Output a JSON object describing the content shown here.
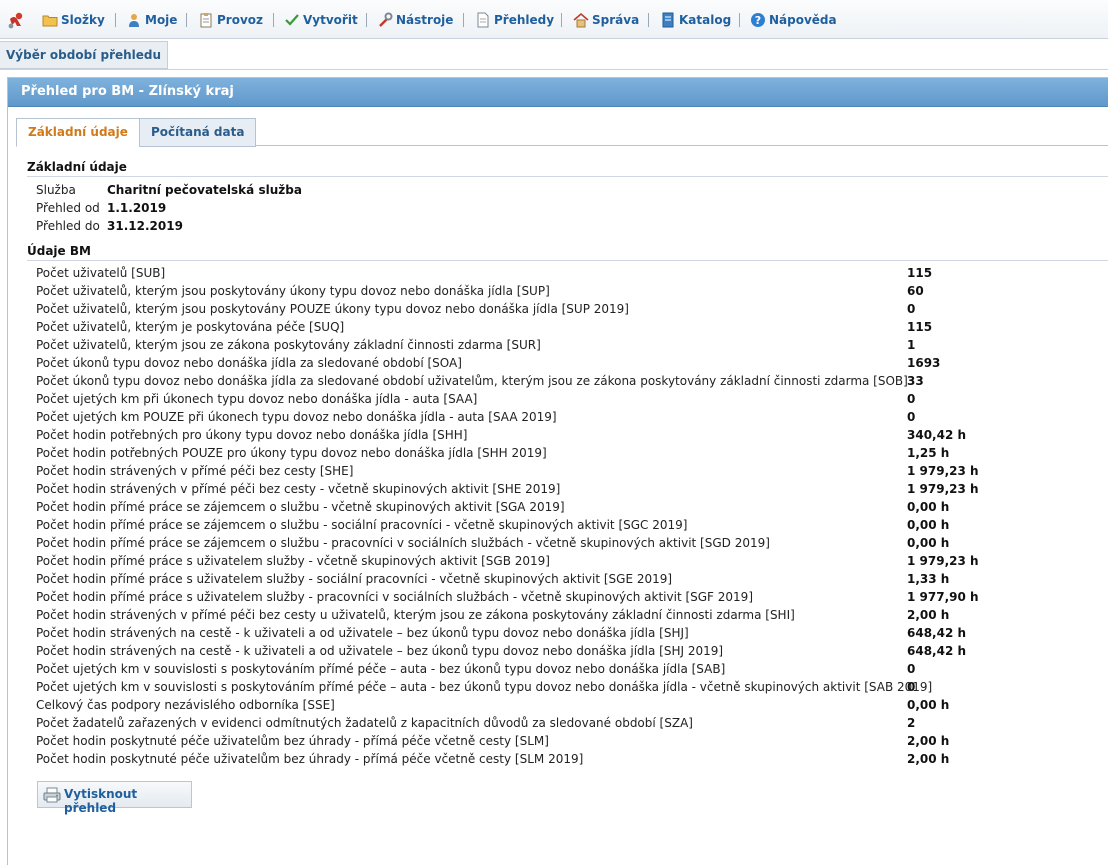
{
  "menu": {
    "items": [
      {
        "label": "Složky",
        "icon": "folder-icon"
      },
      {
        "label": "Moje",
        "icon": "user-icon"
      },
      {
        "label": "Provoz",
        "icon": "clipboard-icon"
      },
      {
        "label": "Vytvořit",
        "icon": "checkmark-icon"
      },
      {
        "label": "Nástroje",
        "icon": "wrench-icon"
      },
      {
        "label": "Přehledy",
        "icon": "document-icon"
      },
      {
        "label": "Správa",
        "icon": "home-icon"
      },
      {
        "label": "Katalog",
        "icon": "book-icon"
      },
      {
        "label": "Nápověda",
        "icon": "help-icon"
      }
    ]
  },
  "subtab": {
    "label": "Výběr období přehledu"
  },
  "panel": {
    "title": "Přehled pro BM - Zlínský kraj",
    "tabs": [
      {
        "label": "Základní údaje",
        "active": true
      },
      {
        "label": "Počítaná data",
        "active": false
      }
    ]
  },
  "basic": {
    "heading": "Základní údaje",
    "rows": [
      {
        "label": "Služba",
        "value": "Charitní pečovatelská služba"
      },
      {
        "label": "Přehled od",
        "value": "1.1.2019"
      },
      {
        "label": "Přehled do",
        "value": "31.12.2019"
      }
    ]
  },
  "bm": {
    "heading": "Údaje BM",
    "rows": [
      {
        "label": "Počet uživatelů [SUB]",
        "value": "115"
      },
      {
        "label": "Počet uživatelů, kterým jsou poskytovány úkony typu dovoz nebo donáška jídla [SUP]",
        "value": "60"
      },
      {
        "label": "Počet uživatelů, kterým jsou poskytovány POUZE úkony typu dovoz nebo donáška jídla [SUP 2019]",
        "value": "0"
      },
      {
        "label": "Počet uživatelů, kterým je poskytována péče [SUQ]",
        "value": "115"
      },
      {
        "label": "Počet uživatelů, kterým jsou ze zákona poskytovány základní činnosti zdarma [SUR]",
        "value": "1"
      },
      {
        "label": "Počet úkonů typu dovoz nebo donáška jídla za sledované období [SOA]",
        "value": "1693"
      },
      {
        "label": "Počet úkonů typu dovoz nebo donáška jídla za sledované období uživatelům, kterým jsou ze zákona poskytovány základní činnosti zdarma [SOB]",
        "value": "33"
      },
      {
        "label": "Počet ujetých km při úkonech typu dovoz nebo donáška jídla - auta [SAA]",
        "value": "0"
      },
      {
        "label": "Počet ujetých km POUZE při úkonech typu dovoz nebo donáška jídla - auta [SAA 2019]",
        "value": "0"
      },
      {
        "label": "Počet hodin potřebných pro úkony typu dovoz nebo donáška jídla [SHH]",
        "value": "340,42 h"
      },
      {
        "label": "Počet hodin potřebných POUZE pro úkony typu dovoz nebo donáška jídla [SHH 2019]",
        "value": "1,25 h"
      },
      {
        "label": "Počet hodin strávených v přímé péči bez cesty [SHE]",
        "value": "1 979,23 h"
      },
      {
        "label": "Počet hodin strávených v přímé péči bez cesty - včetně skupinových aktivit [SHE 2019]",
        "value": "1 979,23 h"
      },
      {
        "label": "Počet hodin přímé práce se zájemcem o službu - včetně skupinových aktivit [SGA 2019]",
        "value": "0,00 h"
      },
      {
        "label": "Počet hodin přímé práce se zájemcem o službu - sociální pracovníci - včetně skupinových aktivit [SGC 2019]",
        "value": "0,00 h"
      },
      {
        "label": "Počet hodin přímé práce se zájemcem o službu - pracovníci v sociálních službách - včetně skupinových aktivit [SGD 2019]",
        "value": "0,00 h"
      },
      {
        "label": "Počet hodin přímé práce s uživatelem služby - včetně skupinových aktivit [SGB 2019]",
        "value": "1 979,23 h"
      },
      {
        "label": "Počet hodin přímé práce s uživatelem služby - sociální pracovníci - včetně skupinových aktivit [SGE 2019]",
        "value": "1,33 h"
      },
      {
        "label": "Počet hodin přímé práce s uživatelem služby - pracovníci v sociálních službách - včetně skupinových aktivit [SGF 2019]",
        "value": "1 977,90 h"
      },
      {
        "label": "Počet hodin strávených v přímé péči bez cesty u uživatelů, kterým jsou ze zákona poskytovány základní činnosti zdarma [SHI]",
        "value": "2,00 h"
      },
      {
        "label": "Počet hodin strávených na cestě - k uživateli a od uživatele – bez úkonů typu dovoz nebo donáška jídla [SHJ]",
        "value": "648,42 h"
      },
      {
        "label": "Počet hodin strávených na cestě - k uživateli a od uživatele – bez úkonů typu dovoz nebo donáška jídla [SHJ 2019]",
        "value": "648,42 h"
      },
      {
        "label": "Počet ujetých km v souvislosti s poskytováním přímé péče – auta - bez úkonů typu dovoz nebo donáška jídla [SAB]",
        "value": "0"
      },
      {
        "label": "Počet ujetých km v souvislosti s poskytováním přímé péče – auta - bez úkonů typu dovoz nebo donáška jídla - včetně skupinových aktivit [SAB 2019]",
        "value": "0"
      },
      {
        "label": "Celkový čas podpory nezávislého odborníka [SSE]",
        "value": "0,00 h"
      },
      {
        "label": "Počet žadatelů zařazených v evidenci odmítnutých žadatelů z kapacitních důvodů za sledované období [SZA]",
        "value": "2"
      },
      {
        "label": "Počet hodin poskytnuté péče uživatelům bez úhrady - přímá péče včetně cesty [SLM]",
        "value": "2,00 h"
      },
      {
        "label": "Počet hodin poskytnuté péče uživatelům bez úhrady - přímá péče včetně cesty [SLM 2019]",
        "value": "2,00 h"
      }
    ]
  },
  "print_button": {
    "label": "Vytisknout přehled",
    "icon": "printer-icon"
  }
}
